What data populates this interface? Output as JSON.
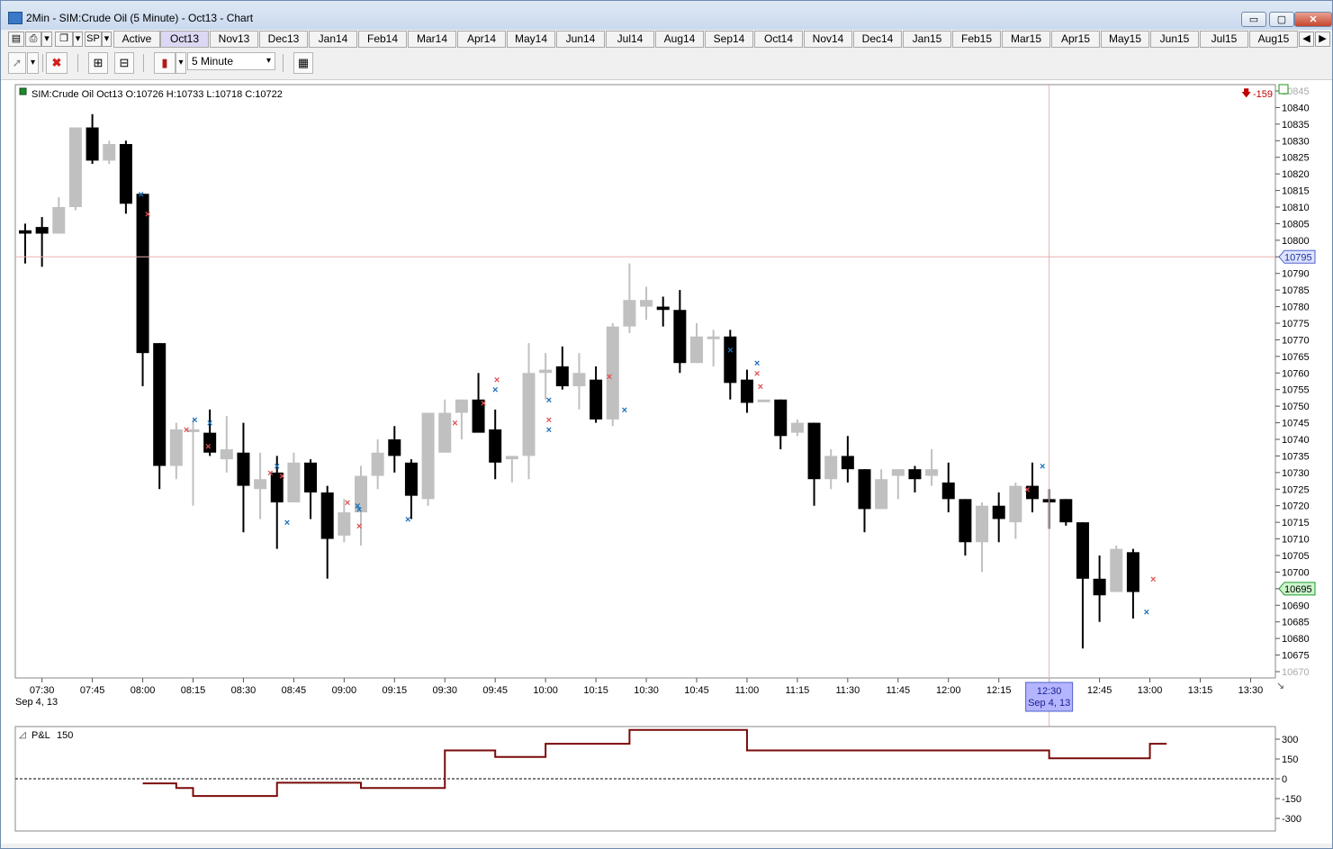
{
  "window": {
    "title": "2Min - SIM:Crude Oil (5 Minute) - Oct13 - Chart",
    "buttons": {
      "minimize": "▭",
      "maximize": "▢",
      "close": "✕"
    }
  },
  "toolbar": {
    "instrument": "SP",
    "active_label": "Active",
    "months": [
      "Oct13",
      "Nov13",
      "Dec13",
      "Jan14",
      "Feb14",
      "Mar14",
      "Apr14",
      "May14",
      "Jun14",
      "Jul14",
      "Aug14",
      "Sep14",
      "Oct14",
      "Nov14",
      "Dec14",
      "Jan15",
      "Feb15",
      "Mar15",
      "Apr15",
      "May15",
      "Jun15",
      "Jul15",
      "Aug15"
    ],
    "selected_month": "Oct13",
    "interval": "5 Minute",
    "icons": [
      "page-setup-icon",
      "print-icon",
      "clone-icon",
      "cursor-icon",
      "close-red-icon",
      "zoom-in-icon",
      "zoom-out-icon",
      "candlestick-icon",
      "properties-icon"
    ]
  },
  "chart_data": {
    "type": "candlestick",
    "header": "SIM:Crude Oil Oct13 O:10726 H:10733 L:10718 C:10722",
    "change_label": "-159",
    "price_label": "10695",
    "crosshair_price_label": "10795",
    "crosshair_time_label": "12:30",
    "crosshair_date_label": "Sep 4, 13",
    "date_label": "Sep 4, 13",
    "ylim": [
      10668,
      10846
    ],
    "yticks": [
      10670,
      10675,
      10680,
      10685,
      10690,
      10695,
      10700,
      10705,
      10710,
      10715,
      10720,
      10725,
      10730,
      10735,
      10740,
      10745,
      10750,
      10755,
      10760,
      10765,
      10770,
      10775,
      10780,
      10785,
      10790,
      10795,
      10800,
      10805,
      10810,
      10815,
      10820,
      10825,
      10830,
      10835,
      10840,
      10845
    ],
    "xticks": [
      "07:30",
      "07:45",
      "08:00",
      "08:15",
      "08:30",
      "08:45",
      "09:00",
      "09:15",
      "09:30",
      "09:45",
      "10:00",
      "10:15",
      "10:30",
      "10:45",
      "11:00",
      "11:15",
      "11:30",
      "11:45",
      "12:00",
      "12:15",
      "12:30",
      "12:45",
      "13:00",
      "13:15",
      "13:30"
    ],
    "start_time": "07:25",
    "bar_minutes": 5,
    "candles": [
      {
        "o": 10803,
        "h": 10805,
        "l": 10793,
        "c": 10802
      },
      {
        "o": 10804,
        "h": 10807,
        "l": 10792,
        "c": 10802
      },
      {
        "o": 10802,
        "h": 10813,
        "l": 10802,
        "c": 10810
      },
      {
        "o": 10810,
        "h": 10834,
        "l": 10809,
        "c": 10834
      },
      {
        "o": 10834,
        "h": 10838,
        "l": 10823,
        "c": 10824
      },
      {
        "o": 10824,
        "h": 10830,
        "l": 10823,
        "c": 10829
      },
      {
        "o": 10829,
        "h": 10830,
        "l": 10808,
        "c": 10811
      },
      {
        "o": 10814,
        "h": 10814,
        "l": 10756,
        "c": 10766
      },
      {
        "o": 10769,
        "h": 10769,
        "l": 10725,
        "c": 10732
      },
      {
        "o": 10732,
        "h": 10745,
        "l": 10728,
        "c": 10743
      },
      {
        "o": 10743,
        "h": 10746,
        "l": 10720,
        "c": 10743
      },
      {
        "o": 10742,
        "h": 10749,
        "l": 10735,
        "c": 10736
      },
      {
        "o": 10734,
        "h": 10747,
        "l": 10730,
        "c": 10737
      },
      {
        "o": 10736,
        "h": 10745,
        "l": 10712,
        "c": 10726
      },
      {
        "o": 10725,
        "h": 10736,
        "l": 10716,
        "c": 10728
      },
      {
        "o": 10730,
        "h": 10735,
        "l": 10707,
        "c": 10721
      },
      {
        "o": 10721,
        "h": 10736,
        "l": 10721,
        "c": 10733
      },
      {
        "o": 10733,
        "h": 10734,
        "l": 10716,
        "c": 10724
      },
      {
        "o": 10724,
        "h": 10726,
        "l": 10698,
        "c": 10710
      },
      {
        "o": 10711,
        "h": 10722,
        "l": 10709,
        "c": 10718
      },
      {
        "o": 10718,
        "h": 10732,
        "l": 10708,
        "c": 10729
      },
      {
        "o": 10729,
        "h": 10740,
        "l": 10725,
        "c": 10736
      },
      {
        "o": 10740,
        "h": 10744,
        "l": 10730,
        "c": 10735
      },
      {
        "o": 10733,
        "h": 10734,
        "l": 10716,
        "c": 10723
      },
      {
        "o": 10722,
        "h": 10748,
        "l": 10720,
        "c": 10748
      },
      {
        "o": 10736,
        "h": 10752,
        "l": 10736,
        "c": 10748
      },
      {
        "o": 10748,
        "h": 10752,
        "l": 10740,
        "c": 10752
      },
      {
        "o": 10752,
        "h": 10760,
        "l": 10745,
        "c": 10742
      },
      {
        "o": 10743,
        "h": 10749,
        "l": 10728,
        "c": 10733
      },
      {
        "o": 10734,
        "h": 10735,
        "l": 10727,
        "c": 10735
      },
      {
        "o": 10735,
        "h": 10769,
        "l": 10728,
        "c": 10760
      },
      {
        "o": 10760,
        "h": 10766,
        "l": 10752,
        "c": 10761
      },
      {
        "o": 10762,
        "h": 10768,
        "l": 10755,
        "c": 10756
      },
      {
        "o": 10756,
        "h": 10766,
        "l": 10749,
        "c": 10760
      },
      {
        "o": 10758,
        "h": 10762,
        "l": 10745,
        "c": 10746
      },
      {
        "o": 10746,
        "h": 10775,
        "l": 10744,
        "c": 10774
      },
      {
        "o": 10774,
        "h": 10793,
        "l": 10772,
        "c": 10782
      },
      {
        "o": 10780,
        "h": 10786,
        "l": 10776,
        "c": 10782
      },
      {
        "o": 10780,
        "h": 10783,
        "l": 10774,
        "c": 10779
      },
      {
        "o": 10779,
        "h": 10785,
        "l": 10760,
        "c": 10763
      },
      {
        "o": 10763,
        "h": 10775,
        "l": 10763,
        "c": 10771
      },
      {
        "o": 10771,
        "h": 10773,
        "l": 10762,
        "c": 10771
      },
      {
        "o": 10771,
        "h": 10773,
        "l": 10752,
        "c": 10757
      },
      {
        "o": 10758,
        "h": 10761,
        "l": 10748,
        "c": 10751
      },
      {
        "o": 10752,
        "h": 10752,
        "l": 10752,
        "c": 10752
      },
      {
        "o": 10752,
        "h": 10752,
        "l": 10737,
        "c": 10741
      },
      {
        "o": 10742,
        "h": 10746,
        "l": 10741,
        "c": 10745
      },
      {
        "o": 10745,
        "h": 10745,
        "l": 10720,
        "c": 10728
      },
      {
        "o": 10728,
        "h": 10737,
        "l": 10725,
        "c": 10735
      },
      {
        "o": 10735,
        "h": 10741,
        "l": 10727,
        "c": 10731
      },
      {
        "o": 10731,
        "h": 10731,
        "l": 10712,
        "c": 10719
      },
      {
        "o": 10719,
        "h": 10731,
        "l": 10719,
        "c": 10728
      },
      {
        "o": 10729,
        "h": 10731,
        "l": 10722,
        "c": 10731
      },
      {
        "o": 10731,
        "h": 10732,
        "l": 10724,
        "c": 10728
      },
      {
        "o": 10729,
        "h": 10737,
        "l": 10726,
        "c": 10731
      },
      {
        "o": 10727,
        "h": 10733,
        "l": 10718,
        "c": 10722
      },
      {
        "o": 10722,
        "h": 10722,
        "l": 10705,
        "c": 10709
      },
      {
        "o": 10709,
        "h": 10721,
        "l": 10700,
        "c": 10720
      },
      {
        "o": 10720,
        "h": 10724,
        "l": 10709,
        "c": 10716
      },
      {
        "o": 10715,
        "h": 10727,
        "l": 10710,
        "c": 10726
      },
      {
        "o": 10726,
        "h": 10733,
        "l": 10718,
        "c": 10722
      },
      {
        "o": 10722,
        "h": 10725,
        "l": 10713,
        "c": 10721
      },
      {
        "o": 10722,
        "h": 10722,
        "l": 10714,
        "c": 10715
      },
      {
        "o": 10715,
        "h": 10715,
        "l": 10677,
        "c": 10698
      },
      {
        "o": 10698,
        "h": 10705,
        "l": 10685,
        "c": 10693
      },
      {
        "o": 10694,
        "h": 10708,
        "l": 10694,
        "c": 10707
      },
      {
        "o": 10706,
        "h": 10707,
        "l": 10686,
        "c": 10694
      }
    ],
    "markers": [
      {
        "i": 6.9,
        "p": 10814,
        "c": "blue"
      },
      {
        "i": 7.3,
        "p": 10808,
        "c": "red"
      },
      {
        "i": 9.6,
        "p": 10743,
        "c": "red"
      },
      {
        "i": 10.1,
        "p": 10746,
        "c": "blue"
      },
      {
        "i": 11.0,
        "p": 10745,
        "c": "blue"
      },
      {
        "i": 10.9,
        "p": 10738,
        "c": "red"
      },
      {
        "i": 14.6,
        "p": 10730,
        "c": "red"
      },
      {
        "i": 15.0,
        "p": 10732,
        "c": "blue"
      },
      {
        "i": 15.3,
        "p": 10729,
        "c": "red"
      },
      {
        "i": 15.6,
        "p": 10715,
        "c": "blue"
      },
      {
        "i": 19.2,
        "p": 10721,
        "c": "red"
      },
      {
        "i": 19.8,
        "p": 10720,
        "c": "blue"
      },
      {
        "i": 19.9,
        "p": 10714,
        "c": "red"
      },
      {
        "i": 19.9,
        "p": 10719,
        "c": "blue"
      },
      {
        "i": 22.8,
        "p": 10716,
        "c": "blue"
      },
      {
        "i": 25.6,
        "p": 10745,
        "c": "red"
      },
      {
        "i": 27.3,
        "p": 10751,
        "c": "red"
      },
      {
        "i": 28.0,
        "p": 10755,
        "c": "blue"
      },
      {
        "i": 28.1,
        "p": 10758,
        "c": "red"
      },
      {
        "i": 31.2,
        "p": 10752,
        "c": "blue"
      },
      {
        "i": 31.2,
        "p": 10746,
        "c": "red"
      },
      {
        "i": 31.2,
        "p": 10743,
        "c": "blue"
      },
      {
        "i": 34.8,
        "p": 10759,
        "c": "red"
      },
      {
        "i": 35.7,
        "p": 10749,
        "c": "blue"
      },
      {
        "i": 42.0,
        "p": 10767,
        "c": "blue"
      },
      {
        "i": 43.6,
        "p": 10763,
        "c": "blue"
      },
      {
        "i": 43.6,
        "p": 10760,
        "c": "red"
      },
      {
        "i": 43.8,
        "p": 10756,
        "c": "red"
      },
      {
        "i": 59.7,
        "p": 10725,
        "c": "red"
      },
      {
        "i": 60.6,
        "p": 10732,
        "c": "blue"
      },
      {
        "i": 66.8,
        "p": 10688,
        "c": "blue"
      },
      {
        "i": 67.2,
        "p": 10698,
        "c": "red"
      }
    ],
    "pnl": {
      "label": "P&L",
      "value_label": "150",
      "yticks": [
        300,
        150,
        0,
        -150,
        -300
      ],
      "ylim": [
        -355,
        355
      ],
      "steps": [
        [
          7.0,
          -35
        ],
        [
          9.0,
          -70
        ],
        [
          10.0,
          -130
        ],
        [
          15.0,
          -30
        ],
        [
          20.0,
          -70
        ],
        [
          25.0,
          215
        ],
        [
          28.0,
          165
        ],
        [
          31.0,
          265
        ],
        [
          36.0,
          370
        ],
        [
          43.0,
          215
        ],
        [
          61.0,
          155
        ],
        [
          67.0,
          265
        ],
        [
          68.0,
          265
        ]
      ]
    }
  }
}
